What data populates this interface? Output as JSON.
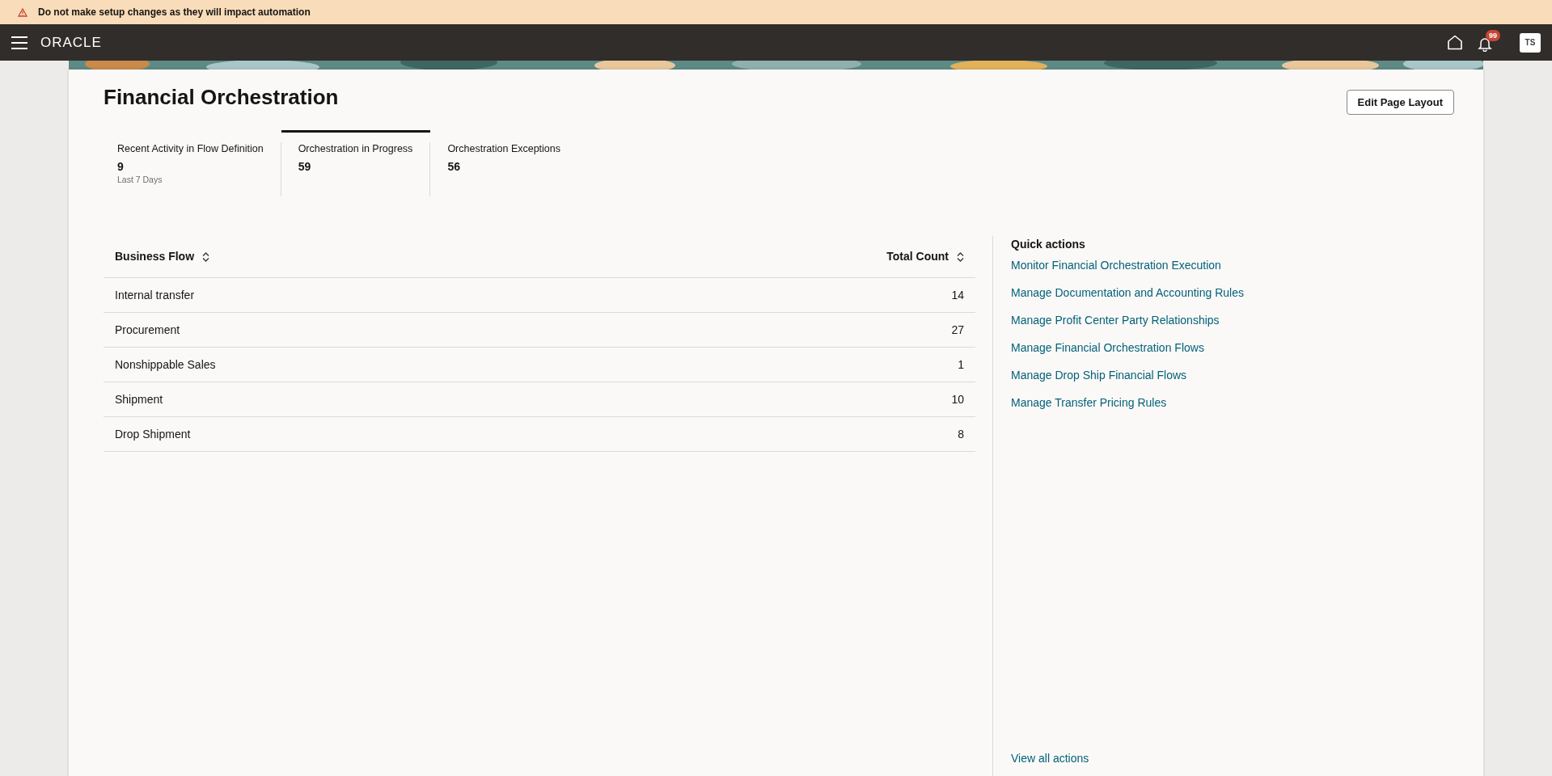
{
  "banner": {
    "message": "Do not make setup changes as they will impact automation"
  },
  "navbar": {
    "logo": "ORACLE",
    "notification_count": "99",
    "user_initials": "TS"
  },
  "page": {
    "title": "Financial Orchestration",
    "edit_button": "Edit Page Layout"
  },
  "tabs": [
    {
      "label": "Recent Activity in Flow Definition",
      "value": "9",
      "caption": "Last 7 Days",
      "selected": false
    },
    {
      "label": "Orchestration in Progress",
      "value": "59",
      "selected": true
    },
    {
      "label": "Orchestration Exceptions",
      "value": "56",
      "selected": false
    }
  ],
  "table": {
    "columns": [
      "Business Flow",
      "Total Count"
    ],
    "rows": [
      [
        "Internal transfer",
        "14"
      ],
      [
        "Procurement",
        "27"
      ],
      [
        "Nonshippable Sales",
        "1"
      ],
      [
        "Shipment",
        "10"
      ],
      [
        "Drop Shipment",
        "8"
      ]
    ]
  },
  "quick_actions": {
    "title": "Quick actions",
    "links": [
      "Monitor Financial Orchestration Execution",
      "Manage Documentation and Accounting Rules",
      "Manage Profit Center Party Relationships",
      "Manage Financial Orchestration Flows",
      "Manage Drop Ship Financial Flows",
      "Manage Transfer Pricing Rules"
    ],
    "view_all": "View all actions"
  }
}
